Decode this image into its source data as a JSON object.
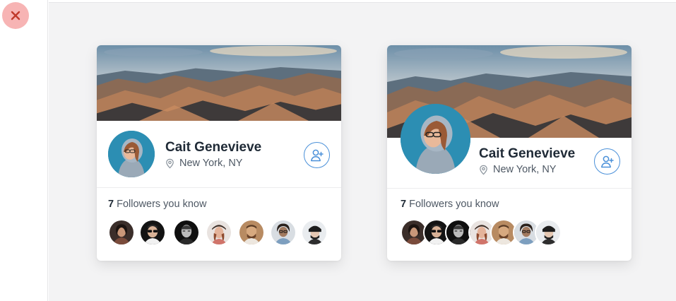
{
  "toolbar": {
    "close_icon": "close-icon"
  },
  "colors": {
    "accent": "#4a90d9",
    "close_bg": "#f7b4b4",
    "close_x": "#c0392b",
    "canvas_bg": "#f3f3f4",
    "text_dark": "#1f2a36",
    "text_muted": "#4e5864"
  },
  "cards": [
    {
      "variant": "compact-avatar",
      "name": "Cait Genevieve",
      "location": "New York, NY",
      "location_icon": "location-pin-icon",
      "follow_icon": "add-user-icon",
      "followers_count": "7",
      "followers_label": " Followers you know",
      "friends_layout": "spaced"
    },
    {
      "variant": "large-overlapping-avatar",
      "name": "Cait Genevieve",
      "location": "New York, NY",
      "location_icon": "location-pin-icon",
      "follow_icon": "add-user-icon",
      "followers_count": "7",
      "followers_label": " Followers you know",
      "friends_layout": "stacked"
    }
  ]
}
